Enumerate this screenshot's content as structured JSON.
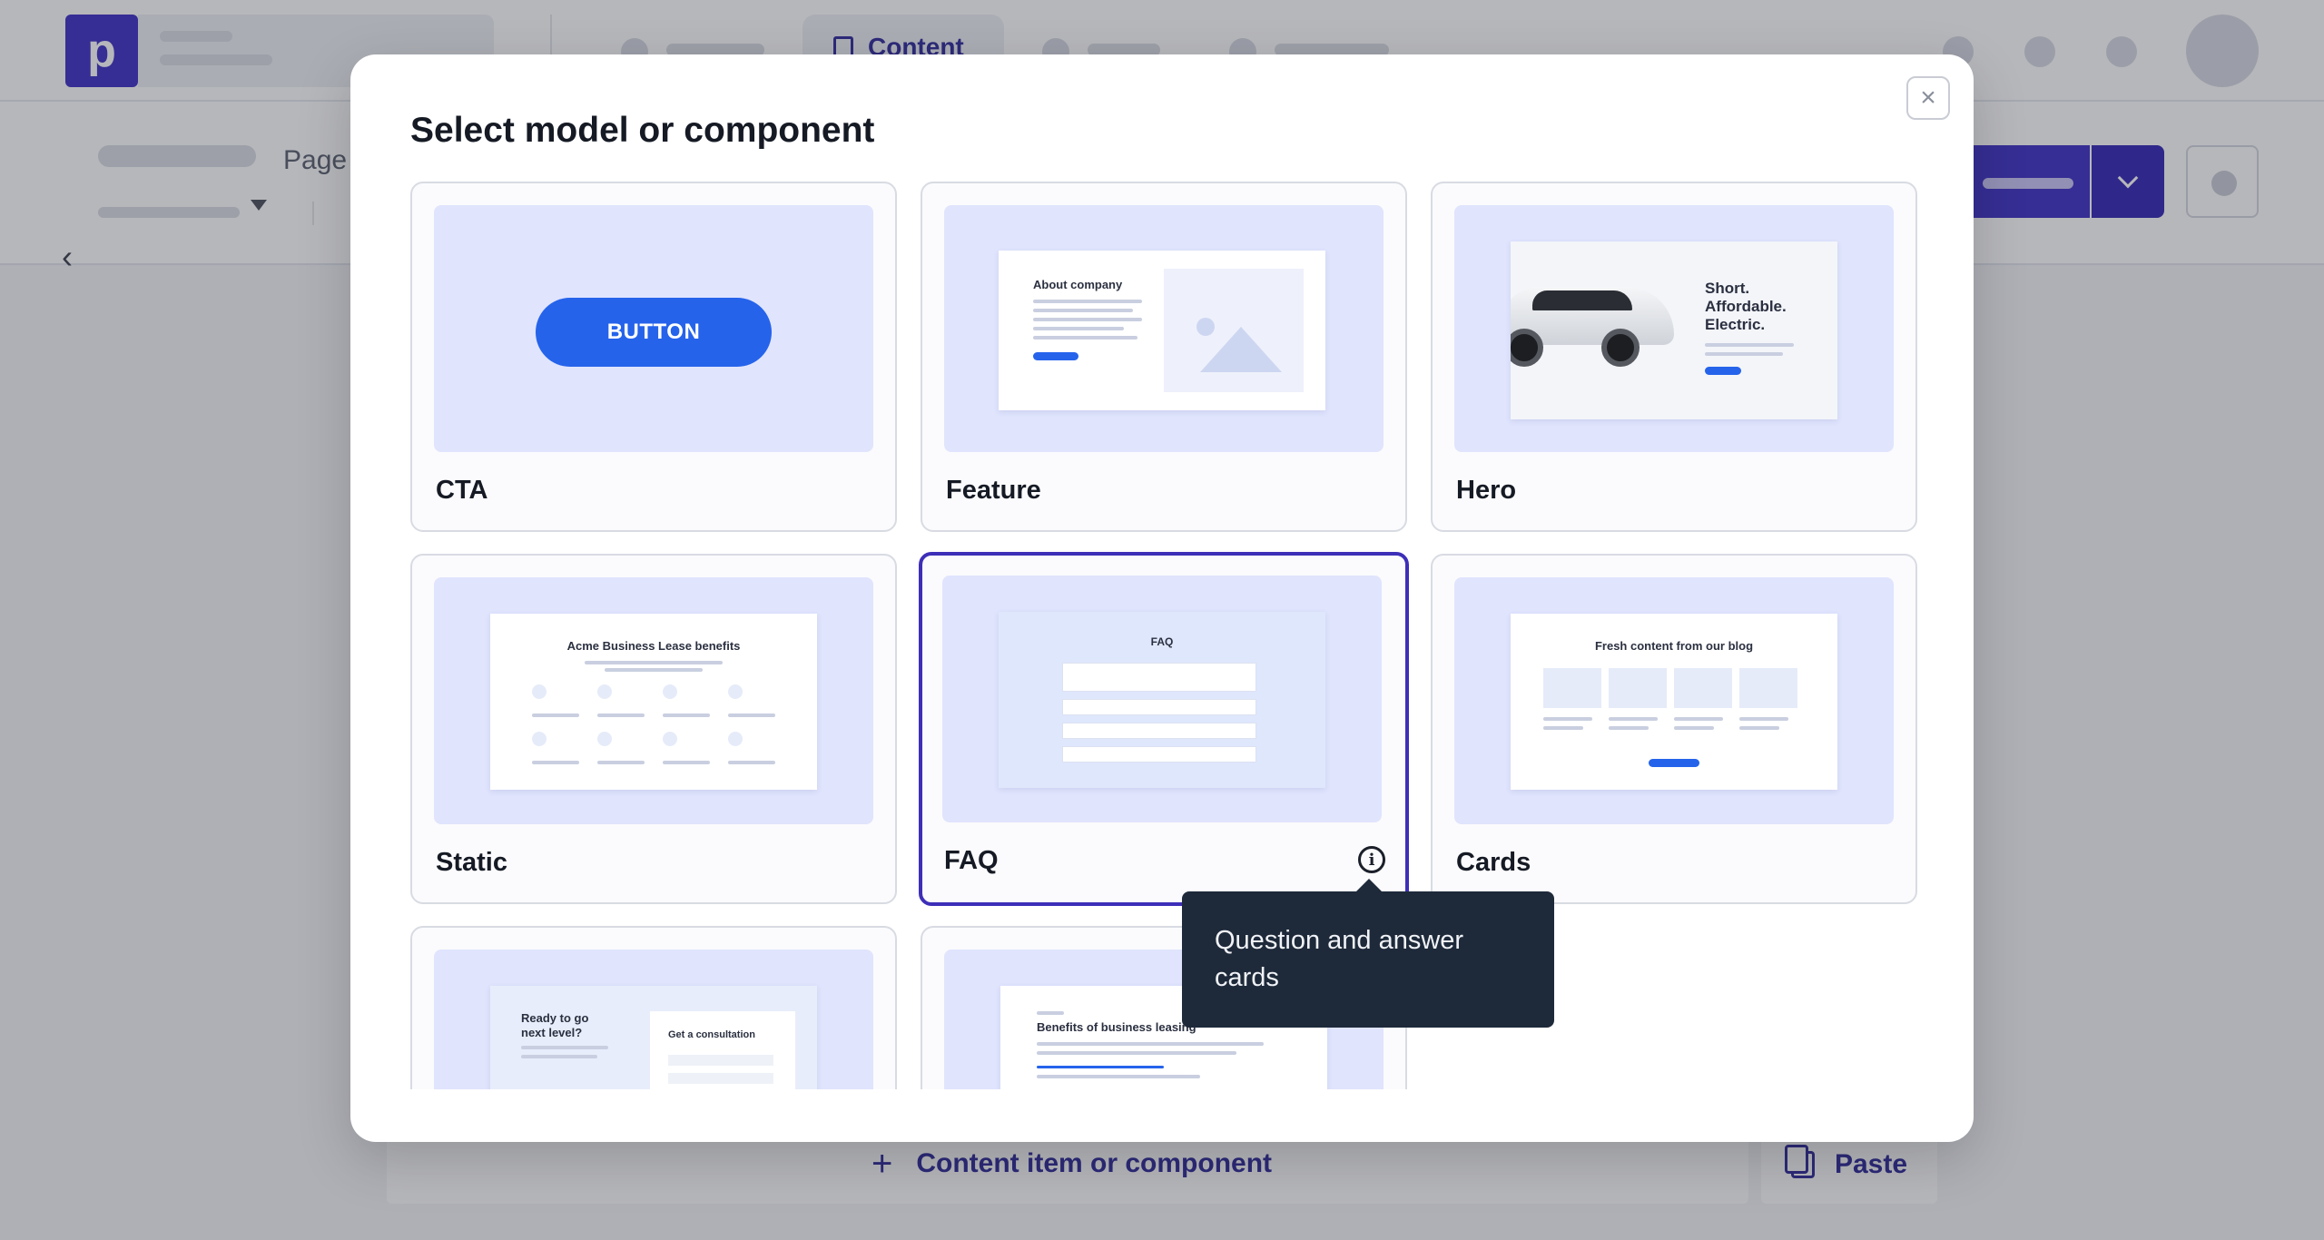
{
  "app": {
    "active_tab": "Content",
    "breadcrumb_page": "Page",
    "footer": {
      "add_label": "Content item or component",
      "paste_label": "Paste"
    }
  },
  "modal": {
    "title": "Select model or component",
    "close_glyph": "×",
    "cards": [
      {
        "label": "CTA",
        "preview_text": "BUTTON"
      },
      {
        "label": "Feature",
        "preview_text": "About company"
      },
      {
        "label": "Hero",
        "preview_text": "Short.\nAffordable.\nElectric."
      },
      {
        "label": "Static",
        "preview_text": "Acme Business Lease benefits"
      },
      {
        "label": "FAQ",
        "preview_text": "FAQ",
        "selected": true
      },
      {
        "label": "Cards",
        "preview_text": "Fresh content from our blog"
      },
      {
        "label": "",
        "preview_text": "Ready to go next level?",
        "preview_text_2": "Get a consultation"
      },
      {
        "label": "",
        "preview_text": "Benefits of business leasing"
      }
    ]
  },
  "tooltip": {
    "text": "Question and answer cards"
  },
  "colors": {
    "brand": "#3d2fc4",
    "selected_border": "#3d2fb8",
    "cta_blue": "#2563eb",
    "tooltip_bg": "#1e2a3a",
    "thumb_bg": "#e0e4fd"
  },
  "icons": [
    "logo-p-icon",
    "document-icon",
    "chevron-left-icon",
    "chevron-down-icon",
    "close-icon",
    "info-icon",
    "plus-icon",
    "paste-icon"
  ]
}
